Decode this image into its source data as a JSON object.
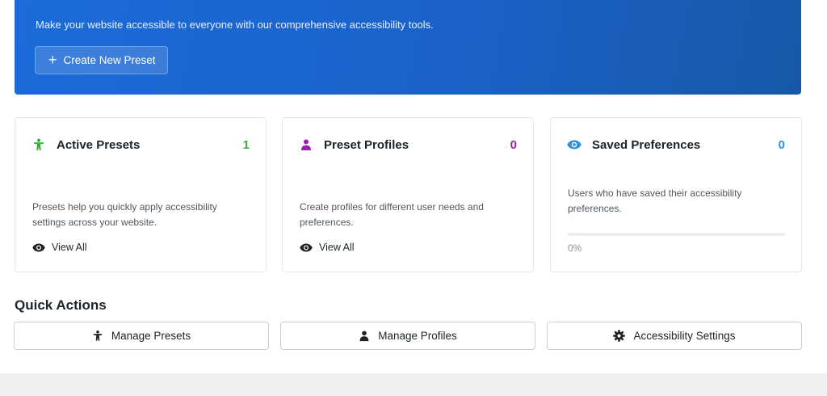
{
  "hero": {
    "description": "Make your website accessible to everyone with our comprehensive accessibility tools.",
    "create_button": "Create New Preset"
  },
  "cards": [
    {
      "title": "Active Presets",
      "count": "1",
      "description": "Presets help you quickly apply accessibility settings across your website.",
      "link": "View All",
      "icon": "accessibility-person-icon",
      "color": "#3cab3e"
    },
    {
      "title": "Preset Profiles",
      "count": "0",
      "description": "Create profiles for different user needs and preferences.",
      "link": "View All",
      "icon": "user-profile-icon",
      "color": "#9b1fb0"
    },
    {
      "title": "Saved Preferences",
      "count": "0",
      "description": "Users who have saved their accessibility preferences.",
      "progress_label": "0%",
      "progress_value": 0,
      "icon": "eye-icon",
      "color": "#2d8fe0"
    }
  ],
  "quick_actions": {
    "title": "Quick Actions",
    "buttons": [
      {
        "label": "Manage Presets",
        "icon": "accessibility-person-icon"
      },
      {
        "label": "Manage Profiles",
        "icon": "user-icon"
      },
      {
        "label": "Accessibility Settings",
        "icon": "gear-icon"
      }
    ]
  }
}
